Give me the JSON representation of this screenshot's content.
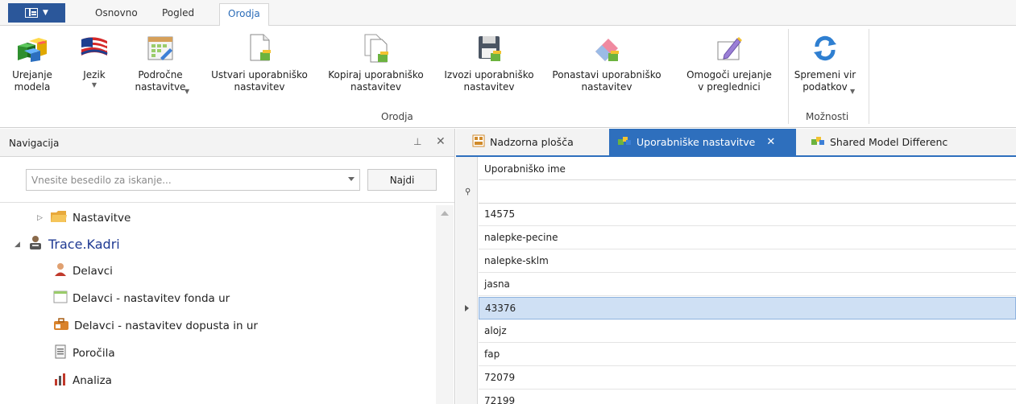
{
  "ribbon": {
    "tabs": [
      "Osnovno",
      "Pogled",
      "Orodja"
    ],
    "active_tab": "Orodja",
    "buttons": {
      "model_edit": "Urejanje\nmodela",
      "language": "Jezik",
      "domain_settings": "Področne\nnastavitve",
      "create_user_settings": "Ustvari uporabniško\nnastavitev",
      "copy_user_settings": "Kopiraj uporabniško\nnastavitev",
      "export_user_settings": "Izvozi uporabniško\nnastavitev",
      "reset_user_settings": "Ponastavi uporabniško\nnastavitev",
      "enable_browser_edit": "Omogoči urejanje\nv preglednici",
      "change_data_source": "Spremeni vir\npodatkov"
    },
    "groups": {
      "tools": "Orodja",
      "options": "Možnosti"
    }
  },
  "navigation": {
    "title": "Navigacija",
    "search_placeholder": "Vnesite besedilo za iskanje...",
    "find_label": "Najdi",
    "tree": [
      {
        "label": "Nastavitve",
        "icon": "folder-icon"
      },
      {
        "label": "Trace.Kadri",
        "icon": "user-group-icon"
      },
      {
        "label": "Delavci",
        "icon": "person-icon"
      },
      {
        "label": "Delavci - nastavitev fonda ur",
        "icon": "calendar-icon"
      },
      {
        "label": "Delavci - nastavitev dopusta in ur",
        "icon": "briefcase-icon"
      },
      {
        "label": "Poročila",
        "icon": "report-icon"
      },
      {
        "label": "Analiza",
        "icon": "chart-icon"
      }
    ]
  },
  "documents": {
    "tabs": [
      "Nadzorna plošča",
      "Uporabniške nastavitve",
      "Shared Model Differenc"
    ],
    "active_tab": "Uporabniške nastavitve"
  },
  "grid": {
    "column": "Uporabniško ime",
    "rows": [
      "14575",
      "nalepke-pecine",
      "nalepke-sklm",
      "jasna",
      "43376",
      "alojz",
      "fap",
      "72079",
      "72199"
    ],
    "selected_row": "43376"
  },
  "colors": {
    "accent": "#2e6fbd",
    "app_button": "#2b579a",
    "selection": "#cfe0f4"
  }
}
